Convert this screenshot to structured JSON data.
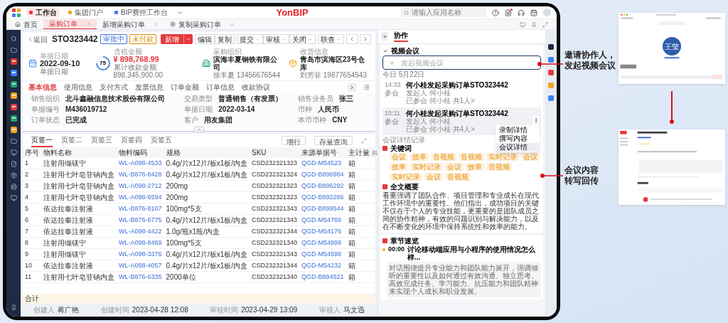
{
  "top_bar": {
    "app_tabs": [
      {
        "label": "工作台",
        "color": "#e4393c",
        "selected": true
      },
      {
        "label": "集团门户",
        "color": "#f5a623",
        "selected": false
      },
      {
        "label": "BIP费控工作台",
        "color": "#4a7cf0",
        "selected": false
      }
    ],
    "brand": "YonBIP",
    "search": {
      "placeholder": "请输入应用名称"
    }
  },
  "page_tabs": [
    {
      "label": "首页",
      "kind": "home",
      "selected": false
    },
    {
      "label": "采购订单",
      "kind": "doc",
      "selected": true
    },
    {
      "label": "新增采购订单",
      "kind": "plain",
      "selected": false
    },
    {
      "label": "复制采购订单",
      "kind": "gear",
      "selected": false
    }
  ],
  "header": {
    "back": "返回",
    "doc_no": "STO323442",
    "badges": [
      {
        "label": "审批中",
        "color": "#3b6fd8"
      },
      {
        "label": "未付款",
        "color": "#d98a00"
      }
    ],
    "primary": "新增",
    "group1": [
      "编辑",
      "复制"
    ],
    "dropdowns": [
      "提交",
      "审核",
      "关闭"
    ],
    "link": "联查"
  },
  "summary": [
    {
      "kind": "date",
      "label": "单据日期",
      "value": "2022-09-10",
      "sub": "单据日期"
    },
    {
      "kind": "amount",
      "progress": "75",
      "level": 0.75,
      "label": "含税金额",
      "value": "¥ 898,768.99",
      "sub": "累计收款金额: 898,345,900.00"
    },
    {
      "kind": "org",
      "label": "采购组织",
      "value": "滨海丰夏钢铁有限公司",
      "sub": "徐丰夏 13456676544"
    },
    {
      "kind": "address",
      "label": "收货信息",
      "value": "青岛市滨海区23号仓库",
      "sub": "刘芳菲 19877654543"
    }
  ],
  "anchors": [
    {
      "label": "基本信息",
      "selected": true
    },
    {
      "label": "使用信息",
      "selected": false
    },
    {
      "label": "支付方式",
      "selected": false
    },
    {
      "label": "发票信息",
      "selected": false
    },
    {
      "label": "订单金额",
      "selected": false
    },
    {
      "label": "订单信息",
      "selected": false
    },
    {
      "label": "收款协议",
      "selected": false
    }
  ],
  "form": [
    {
      "label": "销售组织",
      "value": "北斗鑫融信息技术股份有限公司"
    },
    {
      "label": "交易类型",
      "value": "普通销售（有发票）"
    },
    {
      "label": "销售业务员",
      "value": "张三"
    },
    {
      "label": "单据编号",
      "value": "M436019712"
    },
    {
      "label": "单据日期",
      "value": "2022-03-14"
    },
    {
      "label": "币种",
      "value": "人民币"
    },
    {
      "label": "订单状态",
      "value": "已完成"
    },
    {
      "label": "客户",
      "value": "用友集团"
    },
    {
      "label": "本币币种",
      "value": "CNY"
    }
  ],
  "table": {
    "tabs": [
      {
        "label": "页签一",
        "selected": true
      },
      {
        "label": "页签二",
        "selected": false
      },
      {
        "label": "页签三",
        "selected": false
      },
      {
        "label": "页签四",
        "selected": false
      },
      {
        "label": "页签五",
        "selected": false
      }
    ],
    "buttons": [
      "增行",
      "存量查询"
    ],
    "columns": [
      {
        "label": "序号",
        "kind": "text"
      },
      {
        "label": "物料名称",
        "kind": "text"
      },
      {
        "label": "物料编码",
        "kind": "link"
      },
      {
        "label": "规格",
        "kind": "text"
      },
      {
        "label": "SKU",
        "kind": "text"
      },
      {
        "label": "来源单据号",
        "kind": "link"
      },
      {
        "label": "主计量",
        "kind": "text"
      }
    ],
    "rows": [
      [
        "1",
        "注射用缬镁宁",
        "WL-A098-4533",
        "0.4g/片x12片/板x1板/内盒",
        "CSD232321323",
        "QGD-M54523",
        "箱"
      ],
      [
        "2",
        "注射用七叶皂苷钠内盒",
        "WL-B876-8428",
        "0.4g/片x12片/板x1板/内盒",
        "CSD232321324",
        "QGD-B896984",
        "箱"
      ],
      [
        "3",
        "注射用七叶皂苷钠内盒",
        "WL-A098-2712",
        "200mg",
        "CSD232321323",
        "QGD-B896292",
        "箱"
      ],
      [
        "4",
        "注射用七叶皂苷钠内盒",
        "WL-A098-6594",
        "200mg",
        "CSD232321323",
        "QGD-B892286",
        "箱"
      ],
      [
        "5",
        "依达拉奉注射液",
        "WL-B876-8107",
        "100mg*5支",
        "CSD232321343",
        "QGD-B899544",
        "箱"
      ],
      [
        "6",
        "依达拉奉注射液",
        "WL-B876-6775",
        "0.4g/片x12片/板x1板/内盒",
        "CSD232321343",
        "QGD-M54769",
        "箱"
      ],
      [
        "7",
        "依达拉奉注射液",
        "WL-A098-4422",
        "1.0g/瓶x1瓶/内盒",
        "CSD232321344",
        "QGD-M54176",
        "箱"
      ],
      [
        "8",
        "注射用缬镁宁",
        "WL-A098-8469",
        "100mg*5支",
        "CSD232321340",
        "QGD-M54999",
        "箱"
      ],
      [
        "9",
        "注射用缬镁宁",
        "WL-A098-3376",
        "0.4g/片x12片/板x1板/内盒",
        "CSD232321343",
        "QGD-M54598",
        "箱"
      ],
      [
        "10",
        "依达拉奉注射液",
        "WL-A098-4057",
        "0.4g/片x12片/板x1板/内盒",
        "CSD232321344",
        "QGD-M54232",
        "箱"
      ],
      [
        "11",
        "注射用七叶皂苷钠内盒",
        "WL-B876-6335",
        "2000单位",
        "CSD232321340",
        "QGD-B894521",
        "箱"
      ]
    ],
    "total": "合计"
  },
  "footer": [
    {
      "label": "创建人",
      "value": "蒋广艳"
    },
    {
      "label": "创建时间",
      "value": "2023-04-28 12:08"
    },
    {
      "label": "审核时间",
      "value": "2023-04-29 13:09"
    },
    {
      "label": "审核人",
      "value": "马文迅"
    }
  ],
  "collab": {
    "title": "协作",
    "section": "视频会议",
    "expanded": true,
    "start_label": "发起视频会议",
    "date": "今日 5月22日",
    "meetings": [
      {
        "time": "14:33",
        "status": "参会",
        "title": "何小桂发起采购订单STO323442",
        "initiator": "发起人 何小桂",
        "attendees": "已参会 何小桂 共1人>",
        "selected": false
      },
      {
        "time": "15:11",
        "status": "参会",
        "title": "何小桂发起采购订单STO323442",
        "initiator": "发起人 何小桂",
        "attendees": "已参会 何小桂 共4人>",
        "selected": true
      }
    ],
    "menu": [
      {
        "label": "录制详情",
        "selected": false
      },
      {
        "label": "撰写内容",
        "selected": false
      },
      {
        "label": "会议详情",
        "selected": true
      }
    ],
    "record_title": "会议详情记录",
    "keywords_title": "关键词",
    "keywords": [
      "会议",
      "效率",
      "音视频",
      "音视频",
      "实时记录",
      "会议",
      "效率",
      "实时记录",
      "会议",
      "效率",
      "音视频",
      "实时记录",
      "会议",
      "音视频"
    ],
    "summary_title": "全文概要",
    "summary": "看重强调了团队合作、项目管理和专业成长在现代工作环境中的重要性。他们指出，成功项目的关键不仅在于个人的专业技能，更重要的是团队成员之间的协作精神，有效的问题识别与解决能力，以及在不断变化的环境中保持系统性和效率的能力。",
    "chapters_title": "章节速览",
    "chapter": {
      "time": "00:00",
      "title": "讨论移动端应用与小程序的使用情况怎么样...",
      "text": "对话围绕提升专业能力和团队能力展开，强调倾听的重要性以及如何通过有效沟通、独立思考、高效完成任务、学习能力、抗压能力和团队精神来实现个人成长和职业发展。"
    }
  },
  "callouts": [
    {
      "lines": [
        "邀请协作人，",
        "发起视频会议"
      ]
    },
    {
      "lines": [
        "会议内容",
        "转写回传"
      ]
    }
  ],
  "thumbnails": {
    "avatar": "王莹"
  }
}
